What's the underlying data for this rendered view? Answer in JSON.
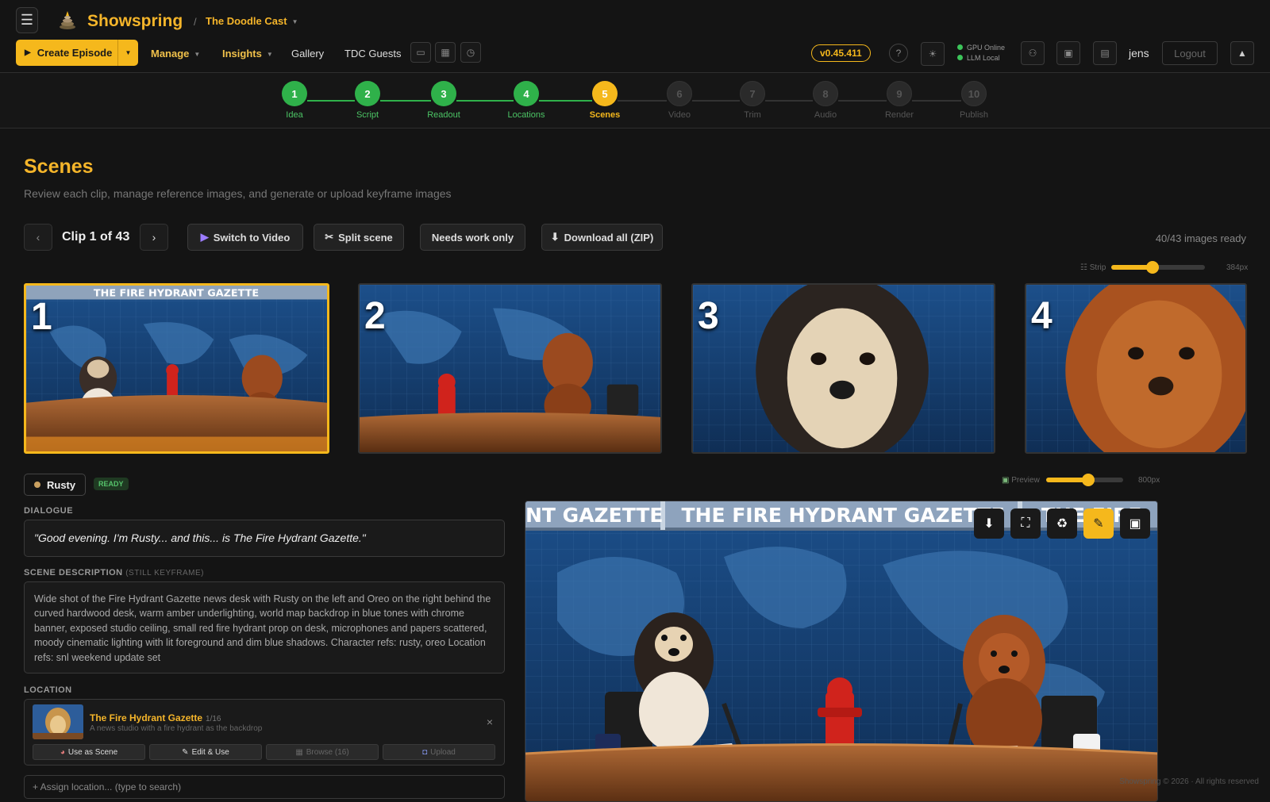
{
  "header": {
    "brand": "Showspring",
    "separator": "/",
    "show_name": "The Doodle Cast",
    "version": "v0.45.411",
    "help": "?",
    "gpu_status": "GPU Online",
    "llm_status": "LLM Local",
    "user": "jens",
    "logout": "Logout"
  },
  "toolbar": {
    "create_label": "Create Episode",
    "nav": [
      "Manage",
      "Insights",
      "Gallery",
      "TDC Guests"
    ]
  },
  "stepper": [
    {
      "num": "1",
      "label": "Idea",
      "state": "done"
    },
    {
      "num": "2",
      "label": "Script",
      "state": "done"
    },
    {
      "num": "3",
      "label": "Readout",
      "state": "done"
    },
    {
      "num": "4",
      "label": "Locations",
      "state": "done"
    },
    {
      "num": "5",
      "label": "Scenes",
      "state": "current"
    },
    {
      "num": "6",
      "label": "Video",
      "state": "todo"
    },
    {
      "num": "7",
      "label": "Trim",
      "state": "todo"
    },
    {
      "num": "8",
      "label": "Audio",
      "state": "todo"
    },
    {
      "num": "9",
      "label": "Render",
      "state": "todo"
    },
    {
      "num": "10",
      "label": "Publish",
      "state": "todo"
    }
  ],
  "page": {
    "title": "Scenes",
    "subtitle": "Review each clip, manage reference images, and generate or upload keyframe images"
  },
  "clipbar": {
    "prev": "‹",
    "next": "›",
    "clip_label": "Clip 1 of 43",
    "switch_video": "Switch to Video",
    "split_scene": "Split scene",
    "needs_work": "Needs work only",
    "download_all": "Download all (ZIP)",
    "ready_count": "40/43 images ready"
  },
  "strip": {
    "label": "Strip",
    "size": "384px",
    "slider_level": 0.44,
    "thumbs": [
      "1",
      "2",
      "3",
      "4"
    ]
  },
  "clip": {
    "character": "Rusty",
    "status": "READY",
    "dialogue_label": "DIALOGUE",
    "dialogue": "\"Good evening. I'm Rusty... and this... is The Fire Hydrant Gazette.\"",
    "desc_label": "SCENE DESCRIPTION",
    "desc_sub": "(STILL KEYFRAME)",
    "description": "Wide shot of the Fire Hydrant Gazette news desk with Rusty on the left and Oreo on the right behind the curved hardwood desk, warm amber underlighting, world map backdrop in blue tones with chrome banner, exposed studio ceiling, small red fire hydrant prop on desk, microphones and papers scattered, moody cinematic lighting with lit foreground and dim blue shadows. Character refs: rusty, oreo Location refs: snl weekend update set",
    "location_label": "LOCATION",
    "location_name": "The Fire Hydrant Gazette",
    "location_count": "1/16",
    "location_desc": "A news studio with a fire hydrant as the backdrop",
    "use_scene": "Use as Scene",
    "edit_use": "Edit & Use",
    "browse": "Browse (16)",
    "upload": "Upload",
    "assign_placeholder": "+ Assign location... (type to search)"
  },
  "preview": {
    "label": "Preview",
    "size": "800px",
    "slider_level": 0.55,
    "banner": "THE FIRE HYDRANT GAZETTE",
    "banner_left": "NT GAZETTE",
    "banner_right": "THE FIRE"
  },
  "footer": "Showspring © 2026 · All rights reserved",
  "colors": {
    "accent": "#f5b81c",
    "done": "#2fb14a"
  }
}
